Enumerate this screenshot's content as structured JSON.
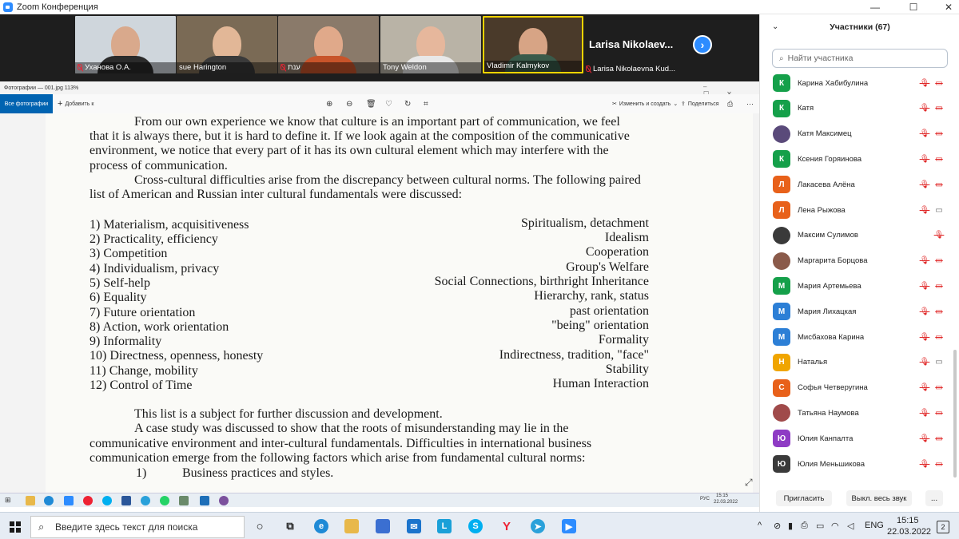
{
  "window": {
    "title": "Zoom Конференция",
    "minimize": "—",
    "maximize": "☐",
    "close": "✕"
  },
  "gallery": {
    "tiles": [
      {
        "name": "Уханова О.А.",
        "muted": true,
        "bg": "#cfd6dc",
        "face": "#d9a98c",
        "body": "#2b2b2b"
      },
      {
        "name": "sue Harington",
        "muted": false,
        "bg": "#7a6a55",
        "face": "#e2b797",
        "body": "#3a3a3a"
      },
      {
        "name": "ענת",
        "muted": true,
        "bg": "#8a7a6a",
        "face": "#e0a98a",
        "body": "#c8542a"
      },
      {
        "name": "Tony Weldon",
        "muted": false,
        "bg": "#b9b3a6",
        "face": "#e6b79c",
        "body": "#e8e8e8"
      },
      {
        "name": "Vladimir Kalmykov",
        "muted": false,
        "bg": "#4a3a2a",
        "face": "#d7a485",
        "body": "#3a5a4a"
      }
    ],
    "big_name": "Larisa Nikolaev...",
    "big_full": "Larisa Nikolaevna Kud..."
  },
  "photos": {
    "title": "Фотографии — 001.jpg   113%",
    "all_photos": "Все фотографии",
    "add_to": "Добавить к",
    "edit_create": "Изменить и создать",
    "share": "Поделиться",
    "zoom_in_icon": "+",
    "zoom_out_icon": "−"
  },
  "document": {
    "para1": [
      "From our own experience we know that culture is an important part of communication, we feel",
      "that it is always there, but it is hard to define it. If we look again at the composition of the communicative",
      "environment, we notice that every part of it has its own cultural element which may interfere with the",
      "process of communication."
    ],
    "para2": [
      "Cross-cultural difficulties arise from the discrepancy between cultural norms. The following paired",
      "list of American and Russian inter cultural fundamentals were discussed:"
    ],
    "list_left": [
      "1) Materialism, acquisitiveness",
      "2) Practicality, efficiency",
      "3) Competition",
      "4) Individualism, privacy",
      "5) Self-help",
      "6) Equality",
      "7) Future orientation",
      "8) Action, work orientation",
      "9) Informality",
      "10) Directness, openness, honesty",
      "11) Change, mobility",
      "12) Control of Time"
    ],
    "list_right": [
      "Spiritualism, detachment",
      "Idealism",
      "Cooperation",
      "Group's Welfare",
      "Social Connections, birthright Inheritance",
      "Hierarchy, rank, status",
      "past orientation",
      "\"being\" orientation",
      "Formality",
      "Indirectness, tradition, \"face\"",
      "Stability",
      "Human Interaction"
    ],
    "para3": "This list is a subject for further discussion and development.",
    "para4": [
      "A case study was discussed to show that the roots of misunderstanding may lie in the",
      "communicative environment and inter-cultural fundamentals. Difficulties in international business",
      "communication emerge from the following factors which arise from fundamental cultural norms:"
    ],
    "item1_num": "1)",
    "item1_text": "Business practices and styles."
  },
  "inner_tray": {
    "lang": "РУС",
    "time": "15:15",
    "date": "22.03.2022"
  },
  "participants": {
    "title": "Участники (67)",
    "search_placeholder": "Найти участника",
    "list": [
      {
        "initial": "К",
        "name": "Карина Хабибулина",
        "color": "#15a04a",
        "video": false
      },
      {
        "initial": "К",
        "name": "Катя",
        "color": "#15a04a",
        "video": false
      },
      {
        "initial": "",
        "name": "Катя Максимец",
        "color": "#5a4a7a",
        "video": false,
        "photo": true
      },
      {
        "initial": "К",
        "name": "Ксения Горяинова",
        "color": "#15a04a",
        "video": false
      },
      {
        "initial": "Л",
        "name": "Лакасева Алёна",
        "color": "#e8611a",
        "video": false
      },
      {
        "initial": "Л",
        "name": "Лена Рыжова",
        "color": "#e8611a",
        "video": true
      },
      {
        "initial": "",
        "name": "Максим Сулимов",
        "color": "#3a3a3a",
        "video": null,
        "photo": true
      },
      {
        "initial": "",
        "name": "Маргарита Борцова",
        "color": "#8a5a4a",
        "video": false,
        "photo": true
      },
      {
        "initial": "М",
        "name": "Мария Артемьева",
        "color": "#15a04a",
        "video": false
      },
      {
        "initial": "М",
        "name": "Мария Лихацкая",
        "color": "#2c7fd6",
        "video": false
      },
      {
        "initial": "М",
        "name": "Мисбахова Карина",
        "color": "#2c7fd6",
        "video": false
      },
      {
        "initial": "Н",
        "name": "Наталья",
        "color": "#f0a500",
        "video": true
      },
      {
        "initial": "С",
        "name": "Софья Четверугина",
        "color": "#e8611a",
        "video": false
      },
      {
        "initial": "",
        "name": "Татьяна Наумова",
        "color": "#a04a4a",
        "video": false,
        "photo": true
      },
      {
        "initial": "Ю",
        "name": "Юлия Канпалта",
        "color": "#8e3bc4",
        "video": false
      },
      {
        "initial": "Ю",
        "name": "Юлия Меньшикова",
        "color": "#3a3a3a",
        "video": false
      }
    ],
    "invite": "Пригласить",
    "mute_all": "Выкл. весь звук",
    "more": "..."
  },
  "taskbar": {
    "search_placeholder": "Введите здесь текст для поиска",
    "lang": "ENG",
    "time": "15:15",
    "date": "22.03.2022",
    "notif": "2"
  }
}
